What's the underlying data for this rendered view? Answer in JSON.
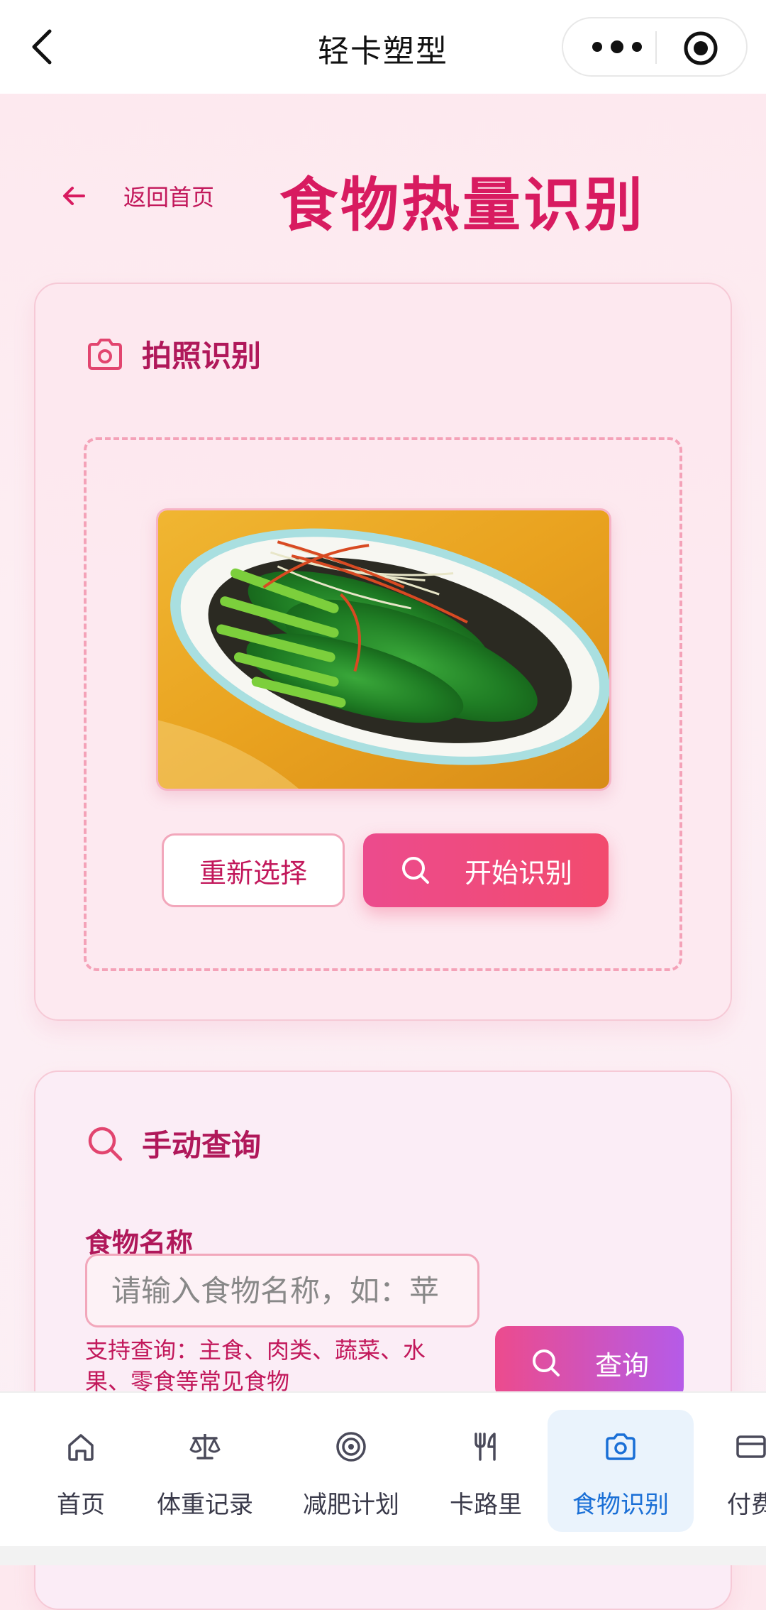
{
  "topbar": {
    "title": "轻卡塑型"
  },
  "header": {
    "back_label": "返回首页",
    "title": "食物热量识别"
  },
  "photo_card": {
    "title": "拍照识别",
    "reselect_label": "重新选择",
    "start_label": "开始识别"
  },
  "manual_card": {
    "title": "手动查询",
    "field_label": "食物名称",
    "placeholder": "请输入食物名称，如：苹",
    "hint": "支持查询：主食、肉类、蔬菜、水果、零食等常见食物",
    "query_label": "查询"
  },
  "tabs": [
    {
      "label": "首页",
      "icon": "home-icon"
    },
    {
      "label": "体重记录",
      "icon": "scale-icon"
    },
    {
      "label": "减肥计划",
      "icon": "target-icon"
    },
    {
      "label": "卡路里",
      "icon": "utensils-icon"
    },
    {
      "label": "食物识别",
      "icon": "camera-icon",
      "active": true
    },
    {
      "label": "付费",
      "icon": "card-icon"
    }
  ],
  "colors": {
    "accent": "#d81b60",
    "tab_active": "#1a6fd6",
    "button_gradient_start": "#ec4b8d"
  }
}
